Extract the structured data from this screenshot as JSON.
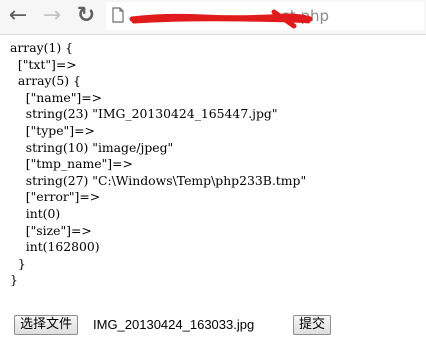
{
  "browser": {
    "back_icon": "arrow-left-icon",
    "forward_icon": "arrow-right-icon",
    "reload_icon": "reload-icon",
    "page_icon": "page-icon",
    "url_visible": "st.php",
    "redaction_color": "#e11b1b"
  },
  "dump_lines": [
    "array(1) {",
    "  [\"txt\"]=>",
    "  array(5) {",
    "    [\"name\"]=>",
    "    string(23) \"IMG_20130424_165447.jpg\"",
    "    [\"type\"]=>",
    "    string(10) \"image/jpeg\"",
    "    [\"tmp_name\"]=>",
    "    string(27) \"C:\\Windows\\Temp\\php233B.tmp\"",
    "    [\"error\"]=>",
    "    int(0)",
    "    [\"size\"]=>",
    "    int(162800)",
    "  }",
    "}"
  ],
  "form": {
    "choose_file_label": "选择文件",
    "file_name": "IMG_20130424_163033.jpg",
    "submit_label": "提交"
  }
}
